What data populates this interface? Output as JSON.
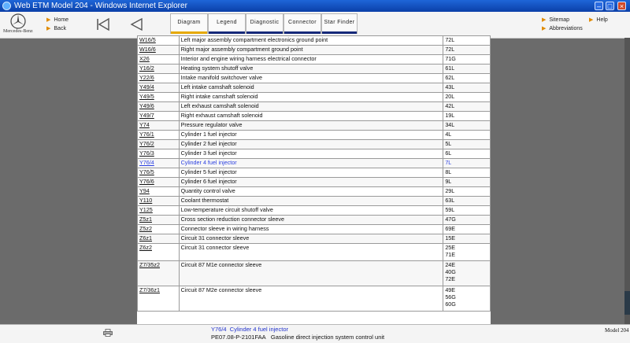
{
  "window": {
    "title": "Web ETM Model 204 - Windows Internet Explorer"
  },
  "header": {
    "brand": "Mercedes-Benz",
    "nav": {
      "home": "Home",
      "back": "Back"
    },
    "tabs": [
      {
        "label": "Diagram",
        "active": true
      },
      {
        "label": "Legend",
        "active": false
      },
      {
        "label": "Diagnostic",
        "active": false
      },
      {
        "label": "Connector",
        "active": false
      },
      {
        "label": "Star Finder",
        "active": false
      }
    ],
    "right": {
      "sitemap": "Sitemap",
      "help": "Help",
      "abbreviations": "Abbreviations"
    }
  },
  "table": {
    "rows": [
      {
        "code": "W16/5",
        "desc": "Left major assembly compartment electronics ground point",
        "loc": [
          "72L"
        ]
      },
      {
        "code": "W16/6",
        "desc": "Right major assembly compartment ground point",
        "loc": [
          "72L"
        ]
      },
      {
        "code": "X26",
        "desc": "Interior and engine wiring harness electrical connector",
        "loc": [
          "71G"
        ]
      },
      {
        "code": "Y16/2",
        "desc": "Heating system shutoff valve",
        "loc": [
          "61L"
        ]
      },
      {
        "code": "Y22/6",
        "desc": "Intake manifold switchover valve",
        "loc": [
          "62L"
        ]
      },
      {
        "code": "Y49/4",
        "desc": "Left intake camshaft solenoid",
        "loc": [
          "43L"
        ]
      },
      {
        "code": "Y49/5",
        "desc": "Right intake camshaft solenoid",
        "loc": [
          "20L"
        ]
      },
      {
        "code": "Y49/6",
        "desc": "Left exhaust camshaft solenoid",
        "loc": [
          "42L"
        ]
      },
      {
        "code": "Y49/7",
        "desc": "Right exhaust camshaft solenoid",
        "loc": [
          "19L"
        ]
      },
      {
        "code": "Y74",
        "desc": "Pressure regulator valve",
        "loc": [
          "34L"
        ]
      },
      {
        "code": "Y76/1",
        "desc": "Cylinder 1 fuel injector",
        "loc": [
          "4L"
        ]
      },
      {
        "code": "Y76/2",
        "desc": "Cylinder 2 fuel injector",
        "loc": [
          "5L"
        ]
      },
      {
        "code": "Y76/3",
        "desc": "Cylinder 3 fuel injector",
        "loc": [
          "6L"
        ]
      },
      {
        "code": "Y76/4",
        "desc": "Cylinder 4 fuel injector",
        "loc": [
          "7L"
        ],
        "selected": true
      },
      {
        "code": "Y76/5",
        "desc": "Cylinder 5 fuel injector",
        "loc": [
          "8L"
        ]
      },
      {
        "code": "Y76/6",
        "desc": "Cylinder 6 fuel injector",
        "loc": [
          "9L"
        ]
      },
      {
        "code": "Y94",
        "desc": "Quantity control valve",
        "loc": [
          "29L"
        ]
      },
      {
        "code": "Y110",
        "desc": "Coolant thermostat",
        "loc": [
          "63L"
        ]
      },
      {
        "code": "Y125",
        "desc": "Low-temperature circuit shutoff valve",
        "loc": [
          "59L"
        ]
      },
      {
        "code": "Z5z1",
        "desc": "Cross section reduction connector sleeve",
        "loc": [
          "47G"
        ]
      },
      {
        "code": "Z5z2",
        "desc": "Connector sleeve in wiring harness",
        "loc": [
          "69E"
        ]
      },
      {
        "code": "Z6z1",
        "desc": "Circuit 31 connector sleeve",
        "loc": [
          "15E"
        ]
      },
      {
        "code": "Z6z2",
        "desc": "Circuit 31 connector sleeve",
        "loc": [
          "25E",
          "71E"
        ]
      },
      {
        "code": "Z7/35z2",
        "desc": "Circuit 87 M1e connector sleeve",
        "loc": [
          "24E",
          "40G",
          "72E"
        ]
      },
      {
        "code": "Z7/36z1",
        "desc": "Circuit 87 M2e connector sleeve",
        "loc": [
          "49E",
          "56G",
          "60G"
        ]
      }
    ]
  },
  "status": {
    "code": "Y76/4",
    "desc": "Cylinder 4 fuel injector",
    "doc_id": "PE07.08-P-2101FAA",
    "doc_title": "Gasoline direct injection system control unit",
    "model": "Model 204"
  }
}
